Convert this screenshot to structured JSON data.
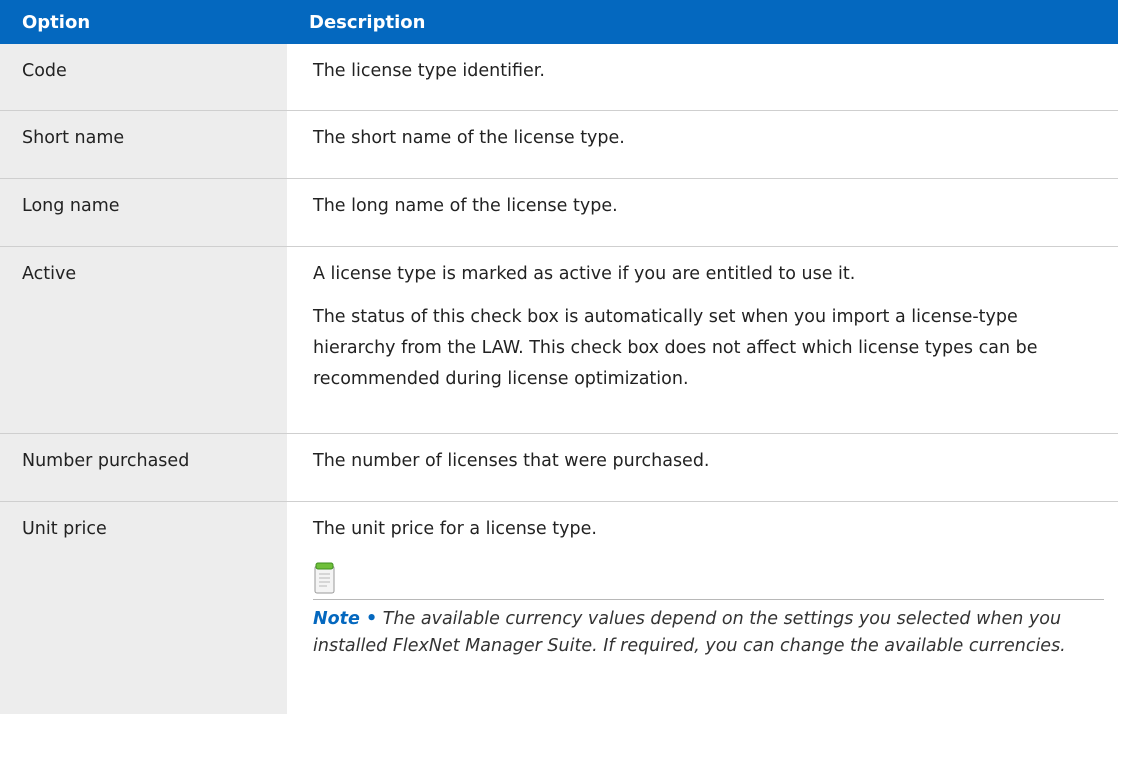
{
  "table": {
    "headers": {
      "option": "Option",
      "description": "Description"
    },
    "rows": [
      {
        "option": "Code",
        "description": "The license type identifier."
      },
      {
        "option": "Short name",
        "description": "The short name of the license type."
      },
      {
        "option": "Long name",
        "description": "The long name of the license type."
      },
      {
        "option": "Active",
        "description": "A license type is marked as active if you are entitled to use it.",
        "description_2": "The status of this check box is automatically set when you import a license-type hierarchy from the LAW. This check box does not affect which license types can be recommended during license optimization."
      },
      {
        "option": "Number purchased",
        "description": "The number of licenses that were purchased."
      },
      {
        "option": "Unit price",
        "description": "The unit price for a license type."
      }
    ]
  },
  "note": {
    "icon": "notepad-icon",
    "label": "Note •",
    "text": "The available currency values depend on the settings you selected when you installed FlexNet Manager Suite. If required, you can change the available currencies."
  },
  "colors": {
    "header_bg": "#0468bf",
    "option_col_bg": "#ededed",
    "note_label": "#0468bf"
  }
}
